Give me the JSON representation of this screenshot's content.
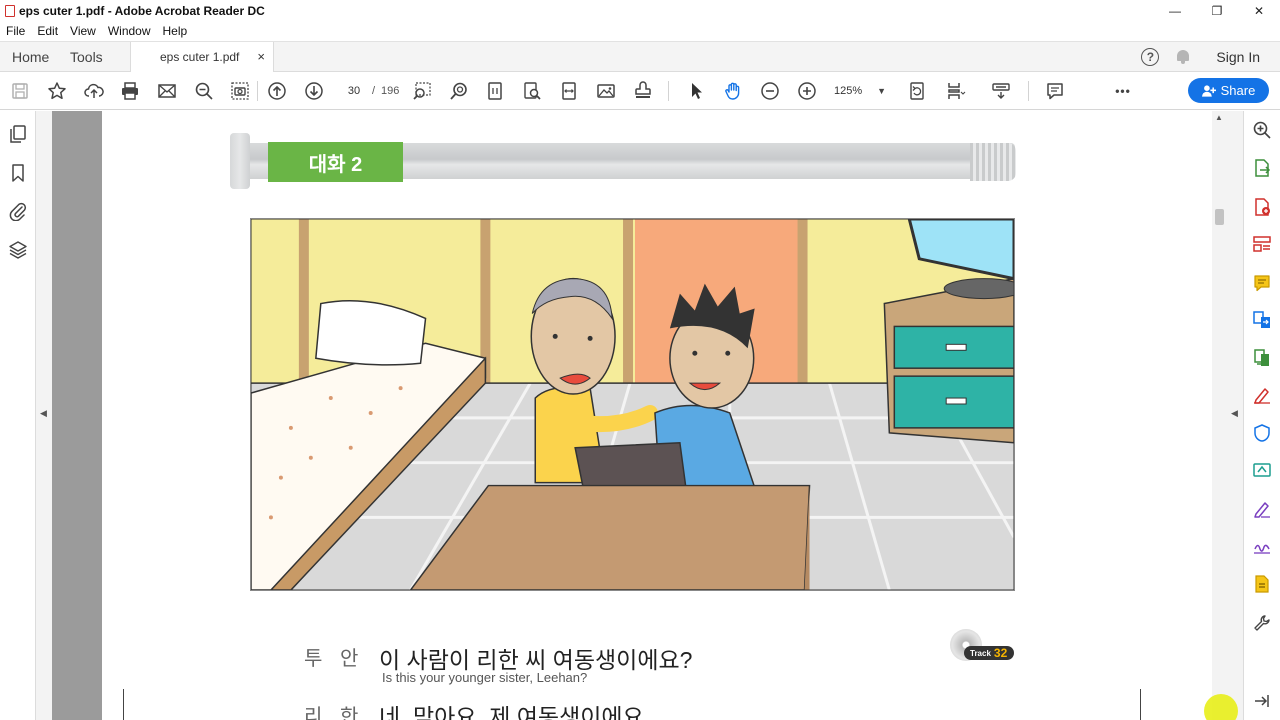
{
  "window": {
    "title": "eps cuter 1.pdf - Adobe Acrobat Reader DC",
    "minimize": "—",
    "maximize": "❐",
    "close": "✕"
  },
  "menu": [
    "File",
    "Edit",
    "View",
    "Window",
    "Help"
  ],
  "tabs": {
    "home": "Home",
    "tools": "Tools",
    "document": "eps cuter 1.pdf",
    "close": "×"
  },
  "header": {
    "help": "?",
    "sign_in": "Sign In"
  },
  "toolbar": {
    "page_current": "30",
    "page_separator": "/",
    "page_total": "196",
    "zoom": "125%",
    "zoom_caret": "▼",
    "more": "•••",
    "share_label": "Share"
  },
  "page": {
    "banner_label": "대화 2",
    "track_label": "Track",
    "track_number": "32",
    "dialogue": [
      {
        "speaker": "투 안",
        "line": "이 사람이 리한 씨 여동생이에요?",
        "translation": "Is this your younger sister, Leehan?"
      },
      {
        "speaker": "리 한",
        "line": "네, 맞아요. 제 여동생이에요."
      }
    ]
  },
  "colors": {
    "accent": "#1473e6",
    "banner_green": "#6ab546",
    "pdf_red": "#d0312d",
    "viewer_gray": "#9b9b9b"
  },
  "icons": {
    "left_panel": [
      "pages-icon",
      "bookmark-icon",
      "attachment-icon",
      "layers-icon"
    ],
    "right_panel": [
      "search-zoom-icon",
      "export-pdf-icon",
      "create-pdf-icon",
      "organize-pages-icon",
      "comment-icon",
      "combine-files-icon",
      "compress-icon",
      "fill-sign-icon",
      "protect-icon",
      "send-review-icon",
      "edit-pdf-icon",
      "sign-icon",
      "scan-icon",
      "tools-more-icon",
      "panel-toggle-icon"
    ]
  }
}
